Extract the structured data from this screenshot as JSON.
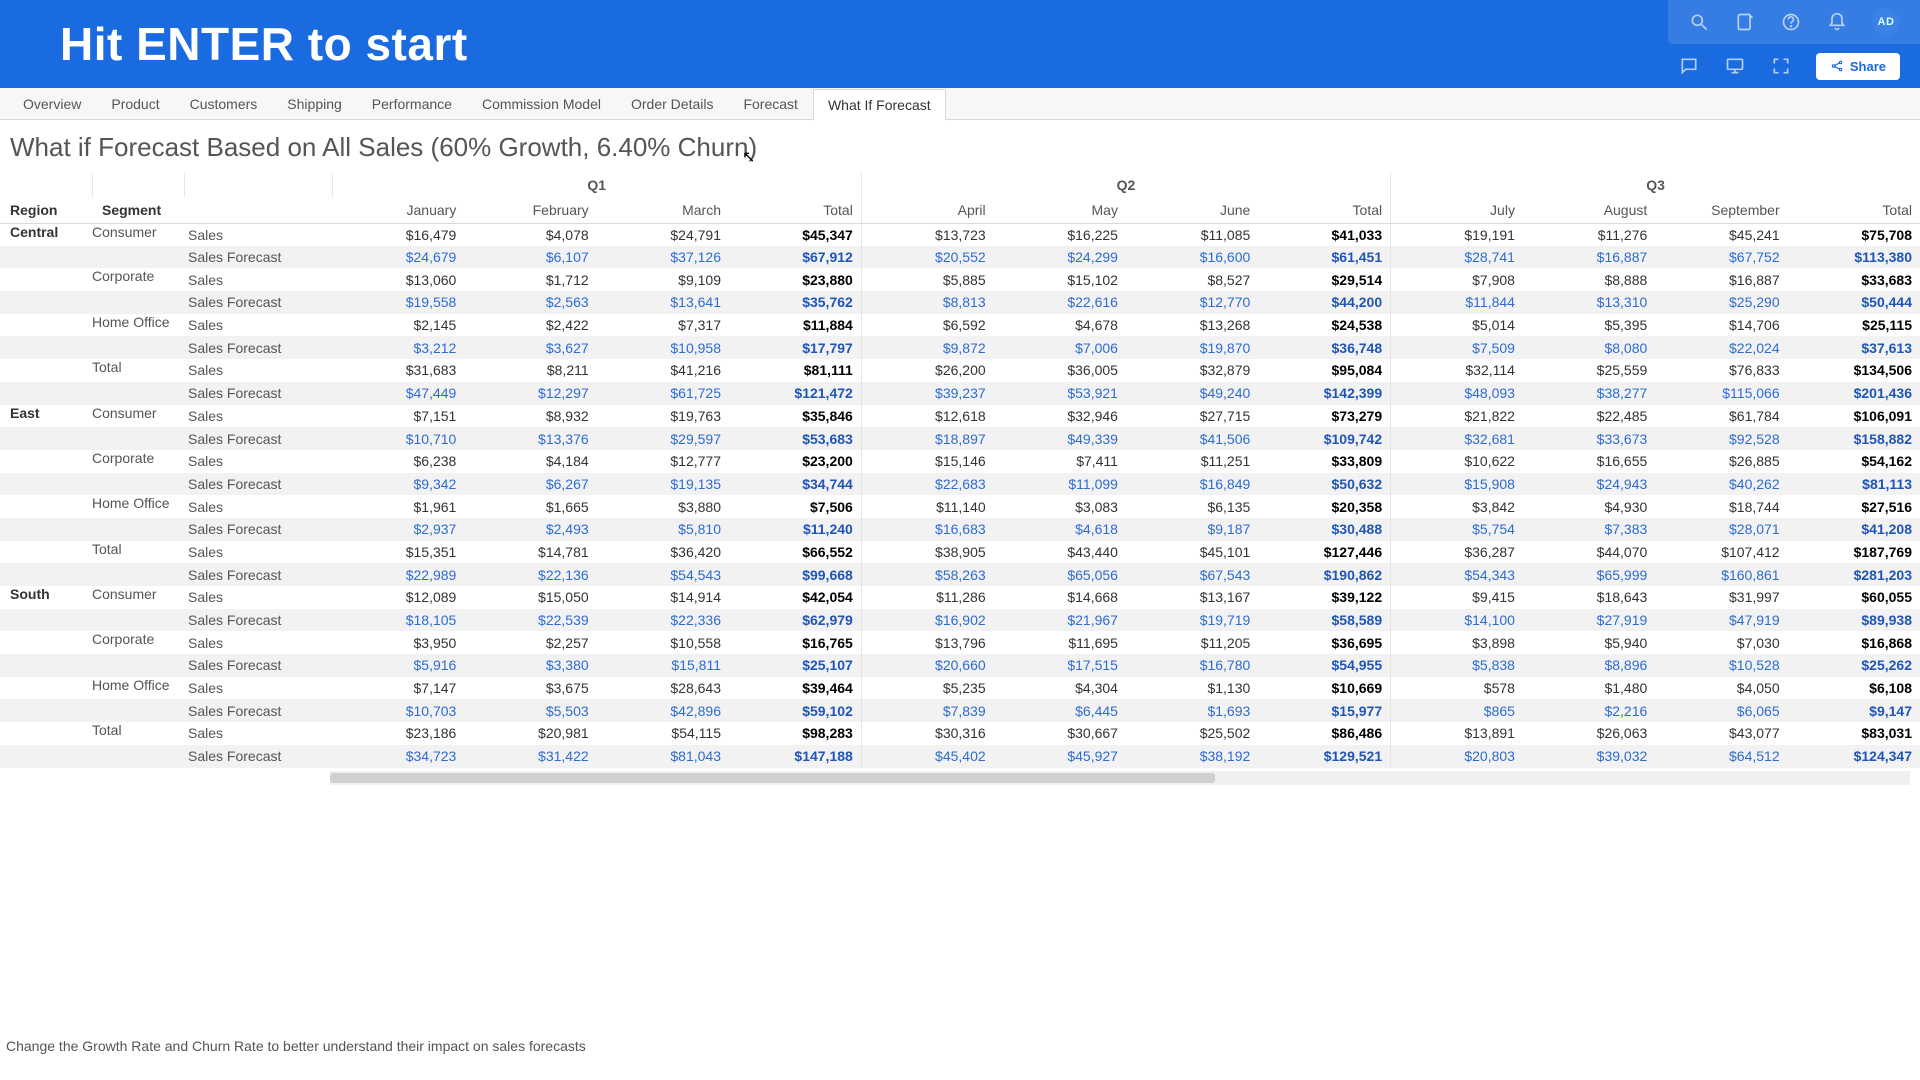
{
  "header": {
    "title": "Hit ENTER to start",
    "avatar_initials": "AD",
    "share_label": "Share"
  },
  "tabs": [
    "Overview",
    "Product",
    "Customers",
    "Shipping",
    "Performance",
    "Commission Model",
    "Order Details",
    "Forecast",
    "What If Forecast"
  ],
  "active_tab": 8,
  "page_title": "What if Forecast Based on All Sales (60% Growth, 6.40% Churn)",
  "footer_note": "Change the Growth Rate and Churn Rate to better understand their impact on sales forecasts",
  "col_labels": {
    "region": "Region",
    "segment": "Segment",
    "quarters": [
      "Q1",
      "Q2",
      "Q3"
    ],
    "months": [
      "January",
      "February",
      "March",
      "Total",
      "April",
      "May",
      "June",
      "Total",
      "July",
      "August",
      "September",
      "Total"
    ]
  },
  "type_labels": {
    "sales": "Sales",
    "forecast": "Sales Forecast"
  },
  "rows": [
    {
      "region": "Central",
      "segment": "Consumer",
      "type": "sales",
      "v": [
        "$16,479",
        "$4,078",
        "$24,791",
        "$45,347",
        "$13,723",
        "$16,225",
        "$11,085",
        "$41,033",
        "$19,191",
        "$11,276",
        "$45,241",
        "$75,708"
      ]
    },
    {
      "region": "",
      "segment": "",
      "type": "forecast",
      "v": [
        "$24,679",
        "$6,107",
        "$37,126",
        "$67,912",
        "$20,552",
        "$24,299",
        "$16,600",
        "$61,451",
        "$28,741",
        "$16,887",
        "$67,752",
        "$113,380"
      ]
    },
    {
      "region": "",
      "segment": "Corporate",
      "type": "sales",
      "v": [
        "$13,060",
        "$1,712",
        "$9,109",
        "$23,880",
        "$5,885",
        "$15,102",
        "$8,527",
        "$29,514",
        "$7,908",
        "$8,888",
        "$16,887",
        "$33,683"
      ]
    },
    {
      "region": "",
      "segment": "",
      "type": "forecast",
      "v": [
        "$19,558",
        "$2,563",
        "$13,641",
        "$35,762",
        "$8,813",
        "$22,616",
        "$12,770",
        "$44,200",
        "$11,844",
        "$13,310",
        "$25,290",
        "$50,444"
      ]
    },
    {
      "region": "",
      "segment": "Home Office",
      "type": "sales",
      "v": [
        "$2,145",
        "$2,422",
        "$7,317",
        "$11,884",
        "$6,592",
        "$4,678",
        "$13,268",
        "$24,538",
        "$5,014",
        "$5,395",
        "$14,706",
        "$25,115"
      ]
    },
    {
      "region": "",
      "segment": "",
      "type": "forecast",
      "v": [
        "$3,212",
        "$3,627",
        "$10,958",
        "$17,797",
        "$9,872",
        "$7,006",
        "$19,870",
        "$36,748",
        "$7,509",
        "$8,080",
        "$22,024",
        "$37,613"
      ]
    },
    {
      "region": "",
      "segment": "Total",
      "type": "sales",
      "v": [
        "$31,683",
        "$8,211",
        "$41,216",
        "$81,111",
        "$26,200",
        "$36,005",
        "$32,879",
        "$95,084",
        "$32,114",
        "$25,559",
        "$76,833",
        "$134,506"
      ]
    },
    {
      "region": "",
      "segment": "",
      "type": "forecast",
      "v": [
        "$47,449",
        "$12,297",
        "$61,725",
        "$121,472",
        "$39,237",
        "$53,921",
        "$49,240",
        "$142,399",
        "$48,093",
        "$38,277",
        "$115,066",
        "$201,436"
      ]
    },
    {
      "region": "East",
      "segment": "Consumer",
      "type": "sales",
      "v": [
        "$7,151",
        "$8,932",
        "$19,763",
        "$35,846",
        "$12,618",
        "$32,946",
        "$27,715",
        "$73,279",
        "$21,822",
        "$22,485",
        "$61,784",
        "$106,091"
      ]
    },
    {
      "region": "",
      "segment": "",
      "type": "forecast",
      "v": [
        "$10,710",
        "$13,376",
        "$29,597",
        "$53,683",
        "$18,897",
        "$49,339",
        "$41,506",
        "$109,742",
        "$32,681",
        "$33,673",
        "$92,528",
        "$158,882"
      ]
    },
    {
      "region": "",
      "segment": "Corporate",
      "type": "sales",
      "v": [
        "$6,238",
        "$4,184",
        "$12,777",
        "$23,200",
        "$15,146",
        "$7,411",
        "$11,251",
        "$33,809",
        "$10,622",
        "$16,655",
        "$26,885",
        "$54,162"
      ]
    },
    {
      "region": "",
      "segment": "",
      "type": "forecast",
      "v": [
        "$9,342",
        "$6,267",
        "$19,135",
        "$34,744",
        "$22,683",
        "$11,099",
        "$16,849",
        "$50,632",
        "$15,908",
        "$24,943",
        "$40,262",
        "$81,113"
      ]
    },
    {
      "region": "",
      "segment": "Home Office",
      "type": "sales",
      "v": [
        "$1,961",
        "$1,665",
        "$3,880",
        "$7,506",
        "$11,140",
        "$3,083",
        "$6,135",
        "$20,358",
        "$3,842",
        "$4,930",
        "$18,744",
        "$27,516"
      ]
    },
    {
      "region": "",
      "segment": "",
      "type": "forecast",
      "v": [
        "$2,937",
        "$2,493",
        "$5,810",
        "$11,240",
        "$16,683",
        "$4,618",
        "$9,187",
        "$30,488",
        "$5,754",
        "$7,383",
        "$28,071",
        "$41,208"
      ]
    },
    {
      "region": "",
      "segment": "Total",
      "type": "sales",
      "v": [
        "$15,351",
        "$14,781",
        "$36,420",
        "$66,552",
        "$38,905",
        "$43,440",
        "$45,101",
        "$127,446",
        "$36,287",
        "$44,070",
        "$107,412",
        "$187,769"
      ]
    },
    {
      "region": "",
      "segment": "",
      "type": "forecast",
      "v": [
        "$22,989",
        "$22,136",
        "$54,543",
        "$99,668",
        "$58,263",
        "$65,056",
        "$67,543",
        "$190,862",
        "$54,343",
        "$65,999",
        "$160,861",
        "$281,203"
      ]
    },
    {
      "region": "South",
      "segment": "Consumer",
      "type": "sales",
      "v": [
        "$12,089",
        "$15,050",
        "$14,914",
        "$42,054",
        "$11,286",
        "$14,668",
        "$13,167",
        "$39,122",
        "$9,415",
        "$18,643",
        "$31,997",
        "$60,055"
      ]
    },
    {
      "region": "",
      "segment": "",
      "type": "forecast",
      "v": [
        "$18,105",
        "$22,539",
        "$22,336",
        "$62,979",
        "$16,902",
        "$21,967",
        "$19,719",
        "$58,589",
        "$14,100",
        "$27,919",
        "$47,919",
        "$89,938"
      ]
    },
    {
      "region": "",
      "segment": "Corporate",
      "type": "sales",
      "v": [
        "$3,950",
        "$2,257",
        "$10,558",
        "$16,765",
        "$13,796",
        "$11,695",
        "$11,205",
        "$36,695",
        "$3,898",
        "$5,940",
        "$7,030",
        "$16,868"
      ]
    },
    {
      "region": "",
      "segment": "",
      "type": "forecast",
      "v": [
        "$5,916",
        "$3,380",
        "$15,811",
        "$25,107",
        "$20,660",
        "$17,515",
        "$16,780",
        "$54,955",
        "$5,838",
        "$8,896",
        "$10,528",
        "$25,262"
      ]
    },
    {
      "region": "",
      "segment": "Home Office",
      "type": "sales",
      "v": [
        "$7,147",
        "$3,675",
        "$28,643",
        "$39,464",
        "$5,235",
        "$4,304",
        "$1,130",
        "$10,669",
        "$578",
        "$1,480",
        "$4,050",
        "$6,108"
      ]
    },
    {
      "region": "",
      "segment": "",
      "type": "forecast",
      "v": [
        "$10,703",
        "$5,503",
        "$42,896",
        "$59,102",
        "$7,839",
        "$6,445",
        "$1,693",
        "$15,977",
        "$865",
        "$2,216",
        "$6,065",
        "$9,147"
      ]
    },
    {
      "region": "",
      "segment": "Total",
      "type": "sales",
      "v": [
        "$23,186",
        "$20,981",
        "$54,115",
        "$98,283",
        "$30,316",
        "$30,667",
        "$25,502",
        "$86,486",
        "$13,891",
        "$26,063",
        "$43,077",
        "$83,031"
      ]
    },
    {
      "region": "",
      "segment": "",
      "type": "forecast",
      "v": [
        "$34,723",
        "$31,422",
        "$81,043",
        "$147,188",
        "$45,402",
        "$45,927",
        "$38,192",
        "$129,521",
        "$20,803",
        "$39,032",
        "$64,512",
        "$124,347"
      ]
    }
  ],
  "chart_data": {
    "type": "table",
    "title": "What If Forecast Based on All Sales (60% Growth, 6.40% Churn)",
    "columns": [
      "January",
      "February",
      "March",
      "Q1 Total",
      "April",
      "May",
      "June",
      "Q2 Total",
      "July",
      "August",
      "September",
      "Q3 Total"
    ],
    "series": [
      {
        "name": "Central / Consumer / Sales",
        "values": [
          16479,
          4078,
          24791,
          45347,
          13723,
          16225,
          11085,
          41033,
          19191,
          11276,
          45241,
          75708
        ]
      },
      {
        "name": "Central / Consumer / Sales Forecast",
        "values": [
          24679,
          6107,
          37126,
          67912,
          20552,
          24299,
          16600,
          61451,
          28741,
          16887,
          67752,
          113380
        ]
      },
      {
        "name": "Central / Corporate / Sales",
        "values": [
          13060,
          1712,
          9109,
          23880,
          5885,
          15102,
          8527,
          29514,
          7908,
          8888,
          16887,
          33683
        ]
      },
      {
        "name": "Central / Corporate / Sales Forecast",
        "values": [
          19558,
          2563,
          13641,
          35762,
          8813,
          22616,
          12770,
          44200,
          11844,
          13310,
          25290,
          50444
        ]
      },
      {
        "name": "Central / Home Office / Sales",
        "values": [
          2145,
          2422,
          7317,
          11884,
          6592,
          4678,
          13268,
          24538,
          5014,
          5395,
          14706,
          25115
        ]
      },
      {
        "name": "Central / Home Office / Sales Forecast",
        "values": [
          3212,
          3627,
          10958,
          17797,
          9872,
          7006,
          19870,
          36748,
          7509,
          8080,
          22024,
          37613
        ]
      },
      {
        "name": "Central / Total / Sales",
        "values": [
          31683,
          8211,
          41216,
          81111,
          26200,
          36005,
          32879,
          95084,
          32114,
          25559,
          76833,
          134506
        ]
      },
      {
        "name": "Central / Total / Sales Forecast",
        "values": [
          47449,
          12297,
          61725,
          121472,
          39237,
          53921,
          49240,
          142399,
          48093,
          38277,
          115066,
          201436
        ]
      },
      {
        "name": "East / Consumer / Sales",
        "values": [
          7151,
          8932,
          19763,
          35846,
          12618,
          32946,
          27715,
          73279,
          21822,
          22485,
          61784,
          106091
        ]
      },
      {
        "name": "East / Consumer / Sales Forecast",
        "values": [
          10710,
          13376,
          29597,
          53683,
          18897,
          49339,
          41506,
          109742,
          32681,
          33673,
          92528,
          158882
        ]
      },
      {
        "name": "East / Corporate / Sales",
        "values": [
          6238,
          4184,
          12777,
          23200,
          15146,
          7411,
          11251,
          33809,
          10622,
          16655,
          26885,
          54162
        ]
      },
      {
        "name": "East / Corporate / Sales Forecast",
        "values": [
          9342,
          6267,
          19135,
          34744,
          22683,
          11099,
          16849,
          50632,
          15908,
          24943,
          40262,
          81113
        ]
      },
      {
        "name": "East / Home Office / Sales",
        "values": [
          1961,
          1665,
          3880,
          7506,
          11140,
          3083,
          6135,
          20358,
          3842,
          4930,
          18744,
          27516
        ]
      },
      {
        "name": "East / Home Office / Sales Forecast",
        "values": [
          2937,
          2493,
          5810,
          11240,
          16683,
          4618,
          9187,
          30488,
          5754,
          7383,
          28071,
          41208
        ]
      },
      {
        "name": "East / Total / Sales",
        "values": [
          15351,
          14781,
          36420,
          66552,
          38905,
          43440,
          45101,
          127446,
          36287,
          44070,
          107412,
          187769
        ]
      },
      {
        "name": "East / Total / Sales Forecast",
        "values": [
          22989,
          22136,
          54543,
          99668,
          58263,
          65056,
          67543,
          190862,
          54343,
          65999,
          160861,
          281203
        ]
      },
      {
        "name": "South / Consumer / Sales",
        "values": [
          12089,
          15050,
          14914,
          42054,
          11286,
          14668,
          13167,
          39122,
          9415,
          18643,
          31997,
          60055
        ]
      },
      {
        "name": "South / Consumer / Sales Forecast",
        "values": [
          18105,
          22539,
          22336,
          62979,
          16902,
          21967,
          19719,
          58589,
          14100,
          27919,
          47919,
          89938
        ]
      },
      {
        "name": "South / Corporate / Sales",
        "values": [
          3950,
          2257,
          10558,
          16765,
          13796,
          11695,
          11205,
          36695,
          3898,
          5940,
          7030,
          16868
        ]
      },
      {
        "name": "South / Corporate / Sales Forecast",
        "values": [
          5916,
          3380,
          15811,
          25107,
          20660,
          17515,
          16780,
          54955,
          5838,
          8896,
          10528,
          25262
        ]
      },
      {
        "name": "South / Home Office / Sales",
        "values": [
          7147,
          3675,
          28643,
          39464,
          5235,
          4304,
          1130,
          10669,
          578,
          1480,
          4050,
          6108
        ]
      },
      {
        "name": "South / Home Office / Sales Forecast",
        "values": [
          10703,
          5503,
          42896,
          59102,
          7839,
          6445,
          1693,
          15977,
          865,
          2216,
          6065,
          9147
        ]
      },
      {
        "name": "South / Total / Sales",
        "values": [
          23186,
          20981,
          54115,
          98283,
          30316,
          30667,
          25502,
          86486,
          13891,
          26063,
          43077,
          83031
        ]
      },
      {
        "name": "South / Total / Sales Forecast",
        "values": [
          34723,
          31422,
          81043,
          147188,
          45402,
          45927,
          38192,
          129521,
          20803,
          39032,
          64512,
          124347
        ]
      }
    ]
  }
}
